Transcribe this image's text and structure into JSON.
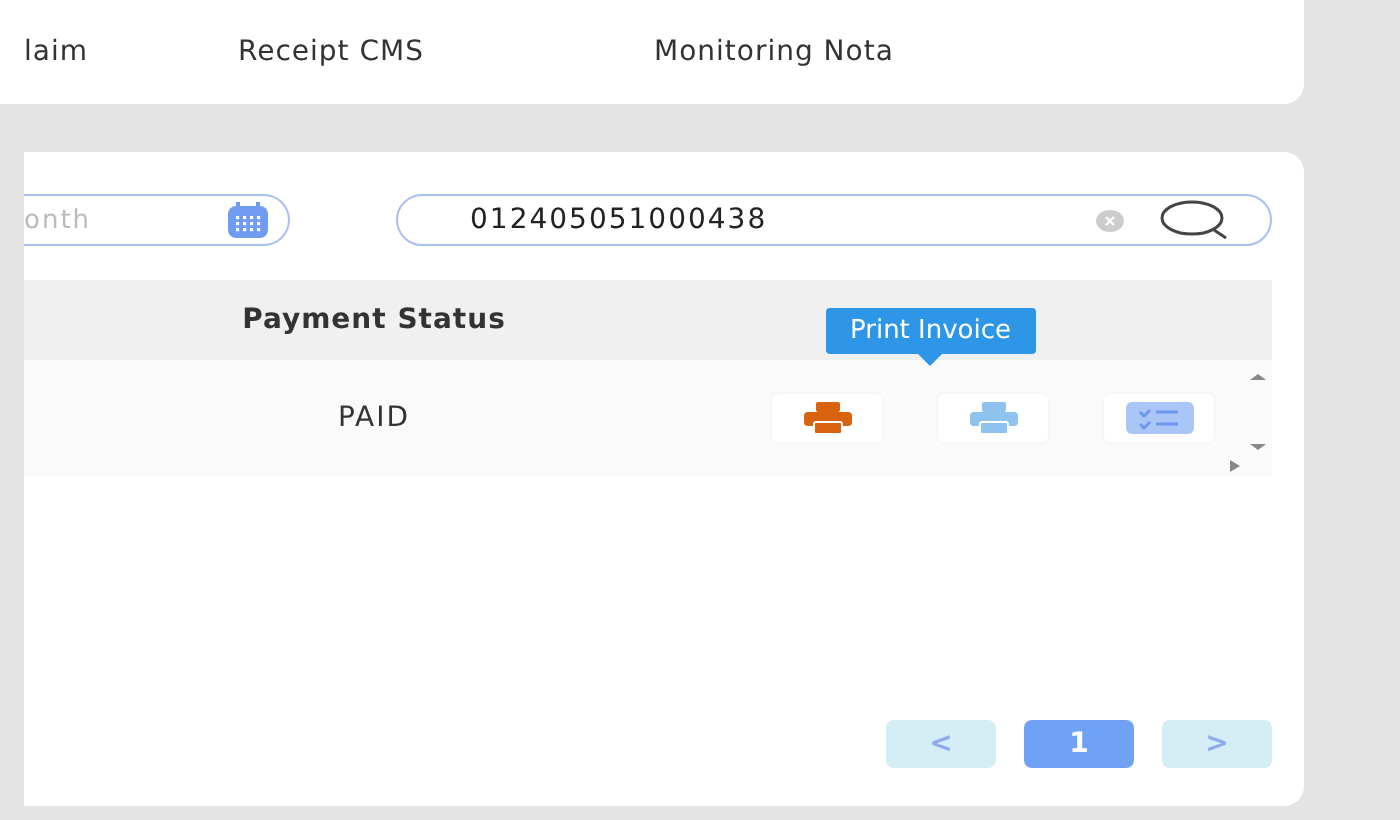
{
  "tabs": [
    {
      "label": "laim"
    },
    {
      "label": "Receipt CMS"
    },
    {
      "label": "Monitoring Nota"
    }
  ],
  "filters": {
    "month": {
      "placeholder": "onth"
    },
    "search": {
      "value": "012405051000438"
    }
  },
  "table": {
    "columns": [
      "Payment Status"
    ],
    "rows": [
      {
        "payment_status": "PAID",
        "actions": [
          {
            "kind": "printer",
            "color": "#d9620e"
          },
          {
            "kind": "printer",
            "color": "#8ec3f0"
          },
          {
            "kind": "checklist",
            "color": "#a9c6f7"
          }
        ]
      }
    ]
  },
  "tooltip": {
    "text": "Print Invoice"
  },
  "pagination": {
    "prev": "<",
    "pages": [
      {
        "label": "1",
        "selected": true
      }
    ],
    "next": ">"
  }
}
